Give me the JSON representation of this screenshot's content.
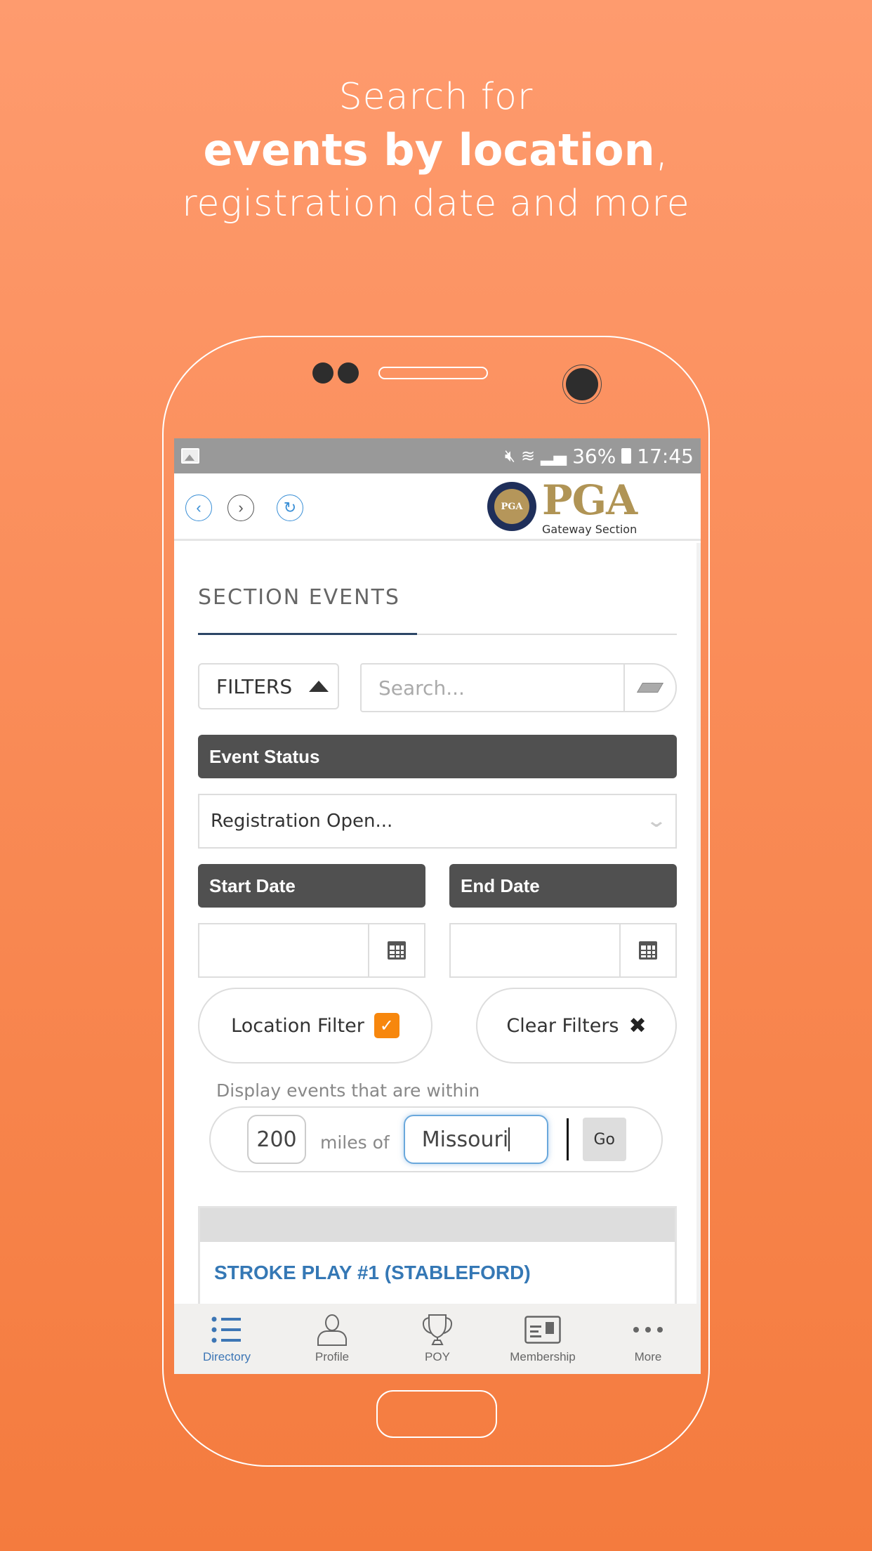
{
  "headline": {
    "line1": "Search for",
    "line2_bold": "events by location",
    "line2_suffix": ",",
    "line3": "registration date and more"
  },
  "colors": {
    "background_top": "#fe9b6e",
    "background_bottom": "#f47b3e",
    "accent_blue": "#3578b5",
    "label_dark": "#505050",
    "checkbox_orange": "#f7870d",
    "pga_gold": "#b09455"
  },
  "statusbar": {
    "left_icon": "image-icon",
    "icons": [
      "mute-icon",
      "wifi-icon",
      "signal-icon"
    ],
    "battery_percent": "36%",
    "time": "17:45"
  },
  "appbar": {
    "back_icon": "‹",
    "forward_icon": "›",
    "refresh_icon": "↻",
    "logo": {
      "seal_text": "PGA",
      "wordmark": "PGA",
      "subtitle": "Gateway Section"
    }
  },
  "page": {
    "title": "SECTION EVENTS",
    "filters_button": "FILTERS",
    "search_placeholder": "Search...",
    "event_status_label": "Event Status",
    "event_status_value": "Registration Open...",
    "start_date_label": "Start Date",
    "start_date_value": "",
    "end_date_label": "End Date",
    "end_date_value": "",
    "location_filter_label": "Location Filter",
    "location_filter_checked": true,
    "clear_filters_label": "Clear Filters",
    "within_label": "Display events that are within",
    "miles_value": "200",
    "miles_of_label": "miles of",
    "location_value": "Missouri",
    "go_button": "Go"
  },
  "results": [
    {
      "title": "STROKE PLAY #1 (STABLEFORD)"
    }
  ],
  "tabbar": {
    "items": [
      {
        "label": "Directory",
        "icon": "list-icon",
        "active": true
      },
      {
        "label": "Profile",
        "icon": "person-icon",
        "active": false
      },
      {
        "label": "POY",
        "icon": "trophy-icon",
        "active": false
      },
      {
        "label": "Membership",
        "icon": "membership-card-icon",
        "active": false
      },
      {
        "label": "More",
        "icon": "more-dots-icon",
        "active": false
      }
    ]
  }
}
